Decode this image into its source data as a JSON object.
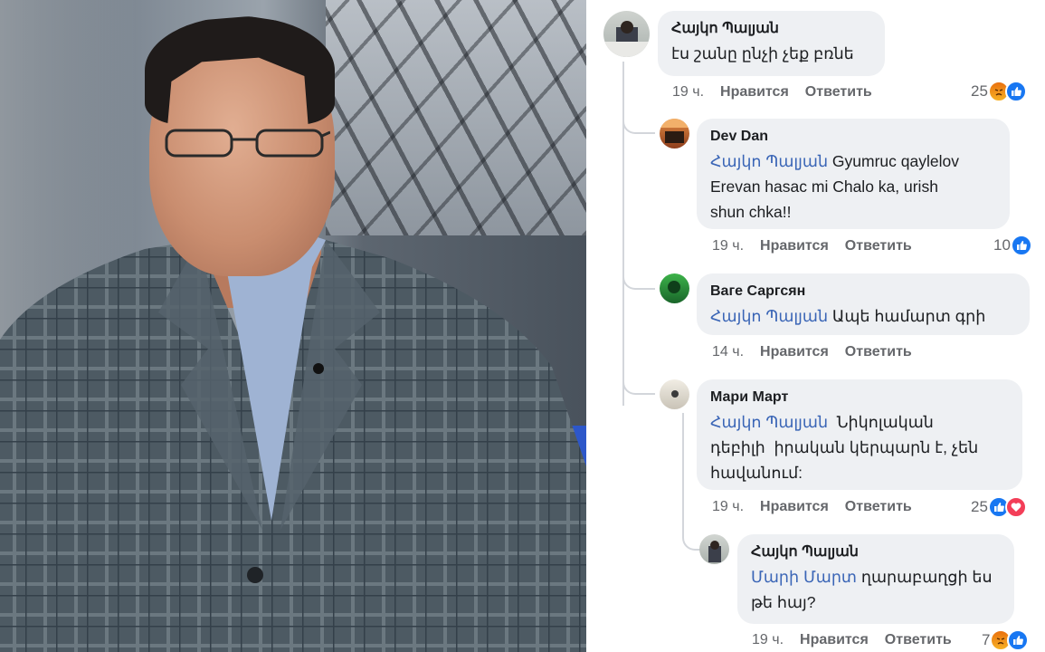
{
  "comments": [
    {
      "author": "Հայկո Պալյան",
      "mention": "",
      "body": "էս շանը ընչի չեք բռնե",
      "time": "19 ч.",
      "like_label": "Нравится",
      "reply_label": "Ответить",
      "reaction_count": "25",
      "reactions": [
        "angry",
        "like"
      ]
    },
    {
      "author": "Dev Dan",
      "mention": "Հայկո Պալյան",
      "body_line1": " Gyumruc qaylelov",
      "body_line2": "Erevan hasac mi Chalo ka, urish",
      "body_line3": "shun chka!!",
      "time": "19 ч.",
      "like_label": "Нравится",
      "reply_label": "Ответить",
      "reaction_count": "10",
      "reactions": [
        "like"
      ]
    },
    {
      "author": "Ваге Саргсян",
      "mention": "Հայկո Պալյան",
      "body_line1": " Ապե համարտ գրի",
      "time": "14 ч.",
      "like_label": "Нравится",
      "reply_label": "Ответить",
      "reaction_count": "",
      "reactions": []
    },
    {
      "author": "Мари Март",
      "mention": "Հայկո Պալյան",
      "body_line1": "  Նիկոլական",
      "body_line2": "դեբիլի  իրական կերպարն է, չեն",
      "body_line3": "հավանում:",
      "time": "19 ч.",
      "like_label": "Нравится",
      "reply_label": "Ответить",
      "reaction_count": "25",
      "reactions": [
        "like",
        "love"
      ]
    },
    {
      "author": "Հայկո Պալյան",
      "mention": "Մարի Մարտ",
      "body_line1": " ղարաբաղցի ես",
      "body_line2": "թե հայ?",
      "time": "19 ч.",
      "like_label": "Нравится",
      "reply_label": "Ответить",
      "reaction_count": "7",
      "reactions": [
        "angry",
        "like"
      ]
    }
  ],
  "colors": {
    "mention": "#3a65b6",
    "bubble": "#eef0f3",
    "like": "#1877f2",
    "love": "#f33e58"
  }
}
